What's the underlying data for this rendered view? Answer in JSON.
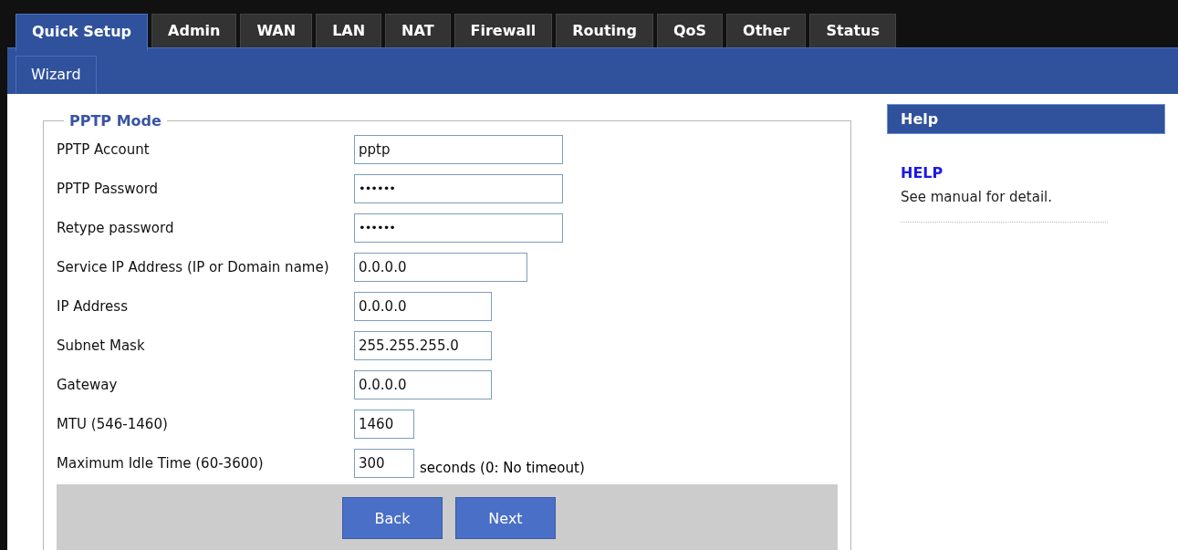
{
  "tabs": [
    {
      "label": "Quick Setup",
      "selected": true
    },
    {
      "label": "Admin",
      "selected": false
    },
    {
      "label": "WAN",
      "selected": false
    },
    {
      "label": "LAN",
      "selected": false
    },
    {
      "label": "NAT",
      "selected": false
    },
    {
      "label": "Firewall",
      "selected": false
    },
    {
      "label": "Routing",
      "selected": false
    },
    {
      "label": "QoS",
      "selected": false
    },
    {
      "label": "Other",
      "selected": false
    },
    {
      "label": "Status",
      "selected": false
    }
  ],
  "subtabs": [
    {
      "label": "Wizard",
      "selected": true
    }
  ],
  "form": {
    "legend": "PPTP Mode",
    "fields": [
      {
        "label": "PPTP Account",
        "kind": "text",
        "value": "pptp"
      },
      {
        "label": "PPTP Password",
        "kind": "password",
        "value": "••••••"
      },
      {
        "label": "Retype password",
        "kind": "password",
        "value": "••••••"
      },
      {
        "label": "Service IP Address (IP or Domain name)",
        "kind": "host",
        "value": "0.0.0.0"
      },
      {
        "label": "IP Address",
        "kind": "ip",
        "value": "0.0.0.0"
      },
      {
        "label": "Subnet Mask",
        "kind": "ip",
        "value": "255.255.255.0"
      },
      {
        "label": "Gateway",
        "kind": "ip",
        "value": "0.0.0.0"
      },
      {
        "label": "MTU (546-1460)",
        "kind": "number",
        "value": "1460"
      },
      {
        "label": "Maximum Idle Time (60-3600)",
        "kind": "number",
        "value": "300",
        "note": "seconds (0: No timeout)"
      }
    ],
    "buttons": [
      "Back",
      "Next"
    ]
  },
  "help": {
    "header": "Help",
    "title": "HELP",
    "text": "See manual for detail."
  }
}
